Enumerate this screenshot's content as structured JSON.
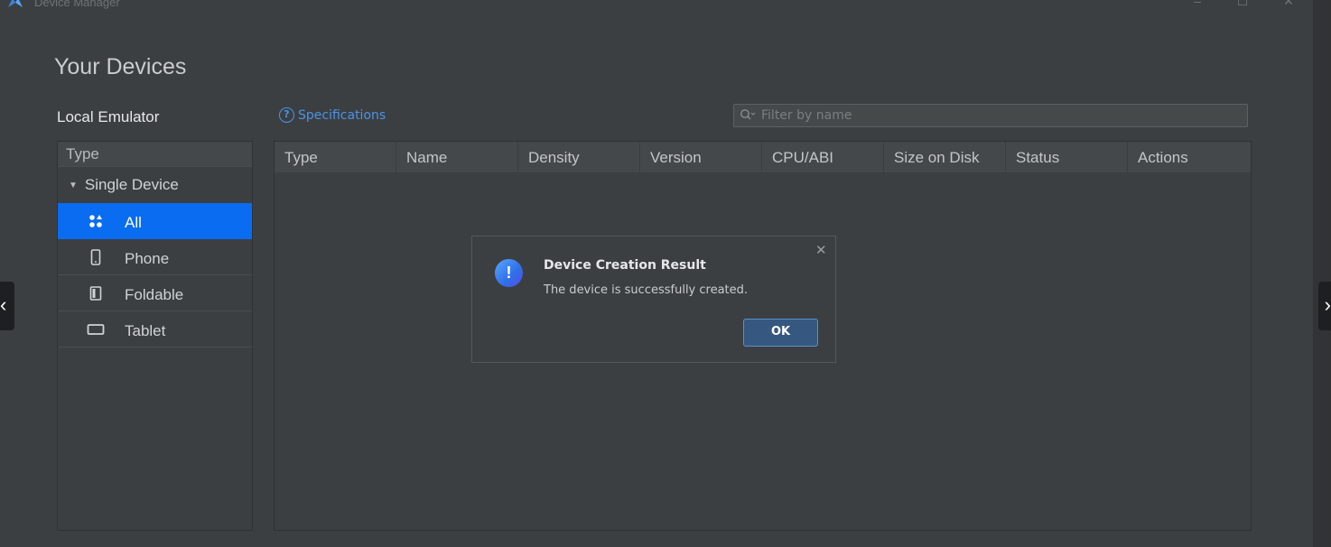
{
  "window": {
    "title": "Device Manager",
    "minimize": "–",
    "maximize": "☐",
    "close": "✕"
  },
  "page": {
    "title": "Your Devices",
    "section": "Local Emulator",
    "spec_link": "Specifications",
    "filter_placeholder": "Filter by name"
  },
  "type_panel": {
    "header": "Type",
    "group": "Single Device",
    "items": [
      {
        "label": "All",
        "icon": "grid-icon",
        "selected": true
      },
      {
        "label": "Phone",
        "icon": "phone-icon",
        "selected": false
      },
      {
        "label": "Foldable",
        "icon": "foldable-icon",
        "selected": false
      },
      {
        "label": "Tablet",
        "icon": "tablet-icon",
        "selected": false
      }
    ]
  },
  "table": {
    "columns": [
      "Type",
      "Name",
      "Density",
      "Version",
      "CPU/ABI",
      "Size on Disk",
      "Status",
      "Actions"
    ],
    "rows": []
  },
  "dialog": {
    "title": "Device Creation Result",
    "message": "The device is successfully created.",
    "ok_label": "OK",
    "icon": "!"
  },
  "colors": {
    "accent": "#0a6cf0",
    "link": "#4a94e8",
    "background": "#3c3f41"
  }
}
